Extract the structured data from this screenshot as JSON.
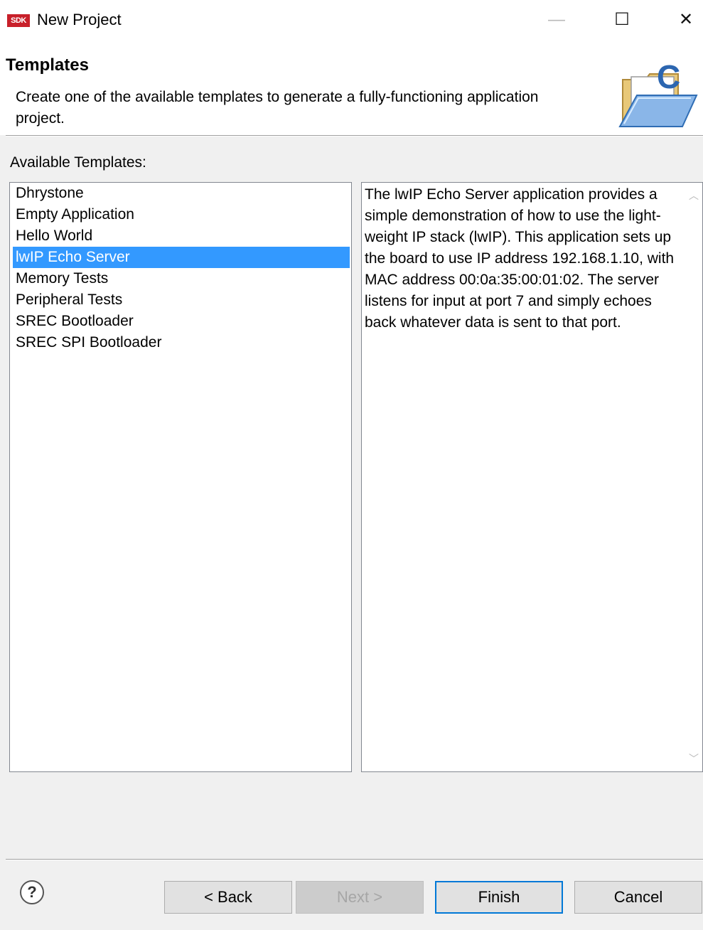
{
  "window": {
    "title": "New Project",
    "app_icon_text": "SDK",
    "minimize_glyph": "—",
    "maximize_glyph": "☐",
    "close_glyph": "✕"
  },
  "header": {
    "title": "Templates",
    "description": "Create one of the available templates to generate a fully-functioning application project.",
    "icon": "c-project-folder-icon"
  },
  "templates": {
    "label": "Available Templates:",
    "items": [
      {
        "label": "Dhrystone",
        "selected": false
      },
      {
        "label": "Empty Application",
        "selected": false
      },
      {
        "label": "Hello World",
        "selected": false
      },
      {
        "label": "lwIP Echo Server",
        "selected": true
      },
      {
        "label": "Memory Tests",
        "selected": false
      },
      {
        "label": "Peripheral Tests",
        "selected": false
      },
      {
        "label": "SREC Bootloader",
        "selected": false
      },
      {
        "label": "SREC SPI Bootloader",
        "selected": false
      }
    ]
  },
  "description": {
    "text": "The lwIP Echo Server application provides a simple demonstration of how to use the light-weight IP stack (lwIP). This application sets up the board to use IP address 192.168.1.10, with MAC address 00:0a:35:00:01:02. The server listens for input at port 7 and simply echoes back whatever data is sent to that port."
  },
  "buttons": {
    "help": "?",
    "back": "< Back",
    "next": "Next >",
    "finish": "Finish",
    "cancel": "Cancel"
  },
  "colors": {
    "selection": "#3399ff",
    "focus_border": "#0078d7"
  }
}
